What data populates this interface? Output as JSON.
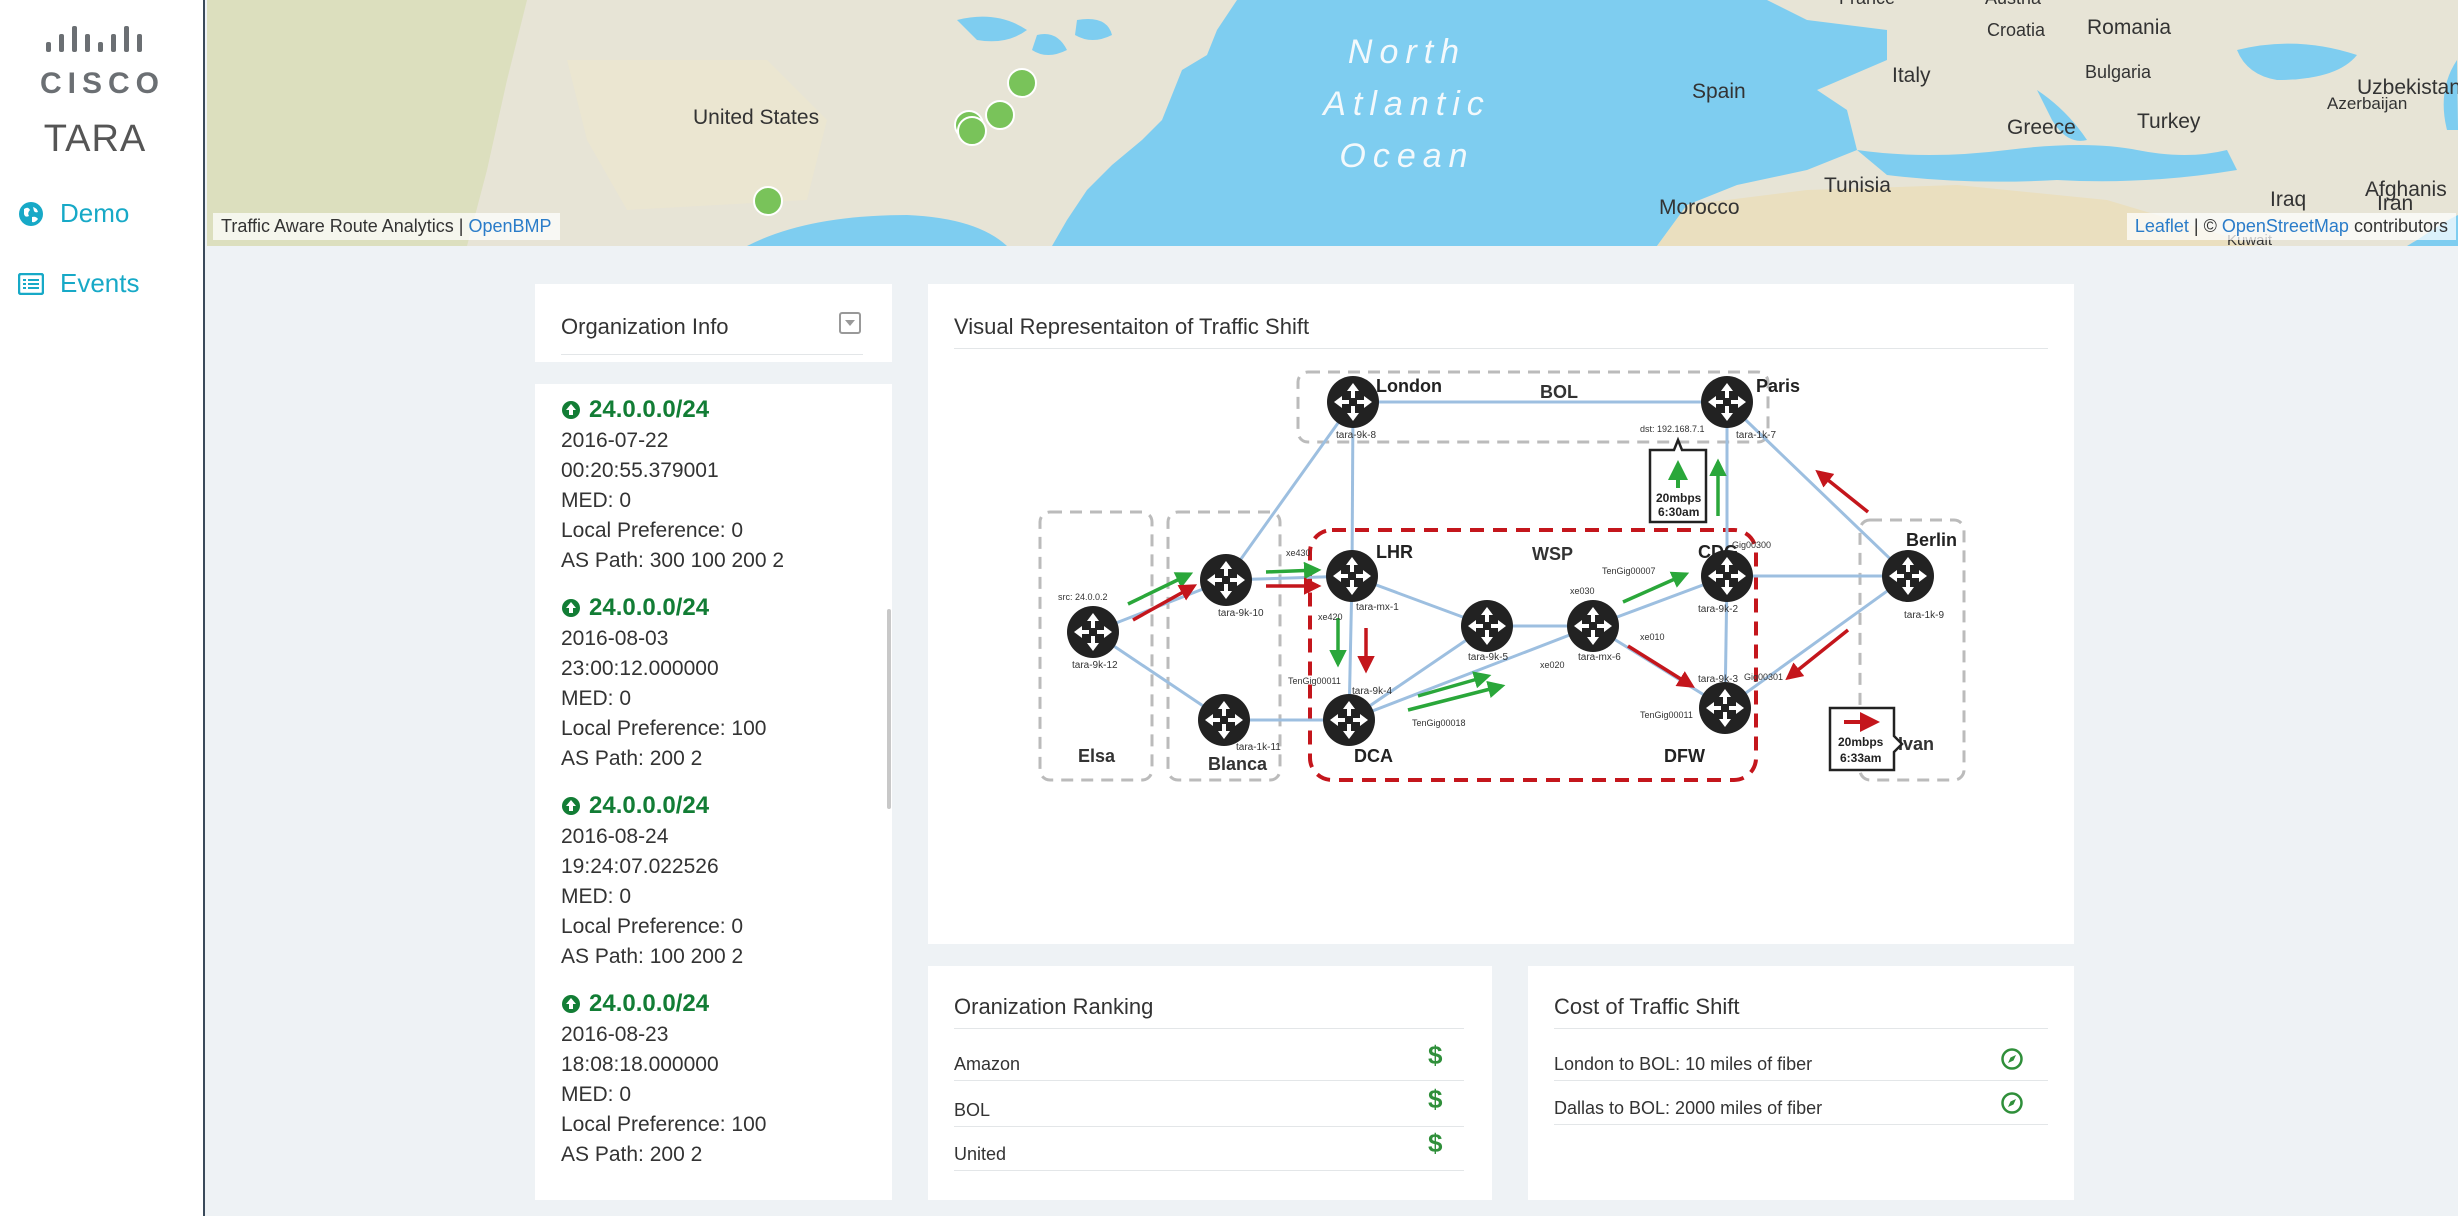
{
  "sidebar": {
    "logo_text": "CISCO",
    "brand": "TARA",
    "nav": [
      {
        "label": "Demo",
        "icon": "globe-icon"
      },
      {
        "label": "Events",
        "icon": "list-icon"
      }
    ]
  },
  "map": {
    "labels": {
      "united_states": "United States",
      "ocean": "North Atlantic Ocean",
      "spain": "Spain",
      "italy": "Italy",
      "greece": "Greece",
      "turkey": "Turkey",
      "morocco": "Morocco",
      "tunisia": "Tunisia",
      "iraq": "Iraq",
      "iran": "Iran",
      "france": "France",
      "austria": "Austria",
      "croatia": "Croatia",
      "romania": "Romania",
      "bulgaria": "Bulgaria",
      "azerbaijan": "Azerbaijan",
      "uzbekistan": "Uzbekistan",
      "afghanistan": "Afghanis",
      "kuwait": "Kuwait"
    },
    "attribution_left": "Traffic Aware Route Analytics |",
    "attribution_left_link": "OpenBMP",
    "attribution_right_leaflet": "Leaflet",
    "attribution_right_sep": "| ©",
    "attribution_right_osm": "OpenStreetMap",
    "attribution_right_tail": "contributors"
  },
  "org_info": {
    "title": "Organization Info",
    "announcements": [
      {
        "prefix": "24.0.0.0/24",
        "date": "2016-07-22",
        "time": "00:20:55.379001",
        "med": "MED: 0",
        "local_pref": "Local Preference: 0",
        "as_path": "AS Path: 300 100 200 2"
      },
      {
        "prefix": "24.0.0.0/24",
        "date": "2016-08-03",
        "time": "23:00:12.000000",
        "med": "MED: 0",
        "local_pref": "Local Preference: 100",
        "as_path": "AS Path: 200 2"
      },
      {
        "prefix": "24.0.0.0/24",
        "date": "2016-08-24",
        "time": "19:24:07.022526",
        "med": "MED: 0",
        "local_pref": "Local Preference: 0",
        "as_path": "AS Path: 100 200 2"
      },
      {
        "prefix": "24.0.0.0/24",
        "date": "2016-08-23",
        "time": "18:08:18.000000",
        "med": "MED: 0",
        "local_pref": "Local Preference: 100",
        "as_path": "AS Path: 200 2"
      }
    ]
  },
  "visual": {
    "title": "Visual Representaiton of Traffic Shift",
    "groups": {
      "bol": "BOL",
      "wsp": "WSP",
      "elsa": "Elsa",
      "blanca": "Blanca",
      "ivan": "Ivan"
    },
    "nodes": {
      "london": "London",
      "london_id": "tara-9k-8",
      "paris": "Paris",
      "paris_id": "tara-1k-7",
      "lhr": "LHR",
      "lhr_id": "tara-mx-1",
      "cdg": "CDG",
      "cdg_id": "tara-9k-2",
      "berlin": "Berlin",
      "berlin_id": "tara-1k-9",
      "elsa_id": "tara-9k-12",
      "b10_id": "tara-9k-10",
      "blanca_id": "tara-1k-11",
      "dca": "DCA",
      "dca_id": "tara-9k-4",
      "n5_id": "tara-9k-5",
      "n6_id": "tara-mx-6",
      "dfw": "DFW",
      "dfw_id": "tara-9k-3"
    },
    "small_labels": {
      "src": "src: 24.0.0.2",
      "dst": "dst: 192.168.7.1",
      "xe430": "xe430",
      "xe420": "xe420",
      "tengig11": "TenGig00011",
      "tengig18": "TenGig00018",
      "xe020": "xe020",
      "xe030": "xe030",
      "xe010": "xe010",
      "tengig7": "TenGig00007",
      "gig300": "Gig00300",
      "gig301": "Gig00301",
      "tengig11b": "TenGig00011"
    },
    "callout_top": {
      "line1": "20mbps",
      "line2": "6:30am"
    },
    "callout_bottom": {
      "line1": "20mbps",
      "line2": "6:33am"
    }
  },
  "ranking": {
    "title": "Oranization Ranking",
    "rows": [
      "Amazon",
      "BOL",
      "United"
    ],
    "symbol": "$"
  },
  "cost": {
    "title": "Cost of Traffic Shift",
    "rows": [
      "London to BOL: 10 miles of fiber",
      "Dallas to BOL: 2000 miles of fiber"
    ]
  },
  "colors": {
    "accent": "#17a9c7",
    "prefix_green": "#127d35",
    "dollar_green": "#2f8f3a",
    "shift_red": "#c4161c",
    "shift_green": "#2aa73a"
  }
}
